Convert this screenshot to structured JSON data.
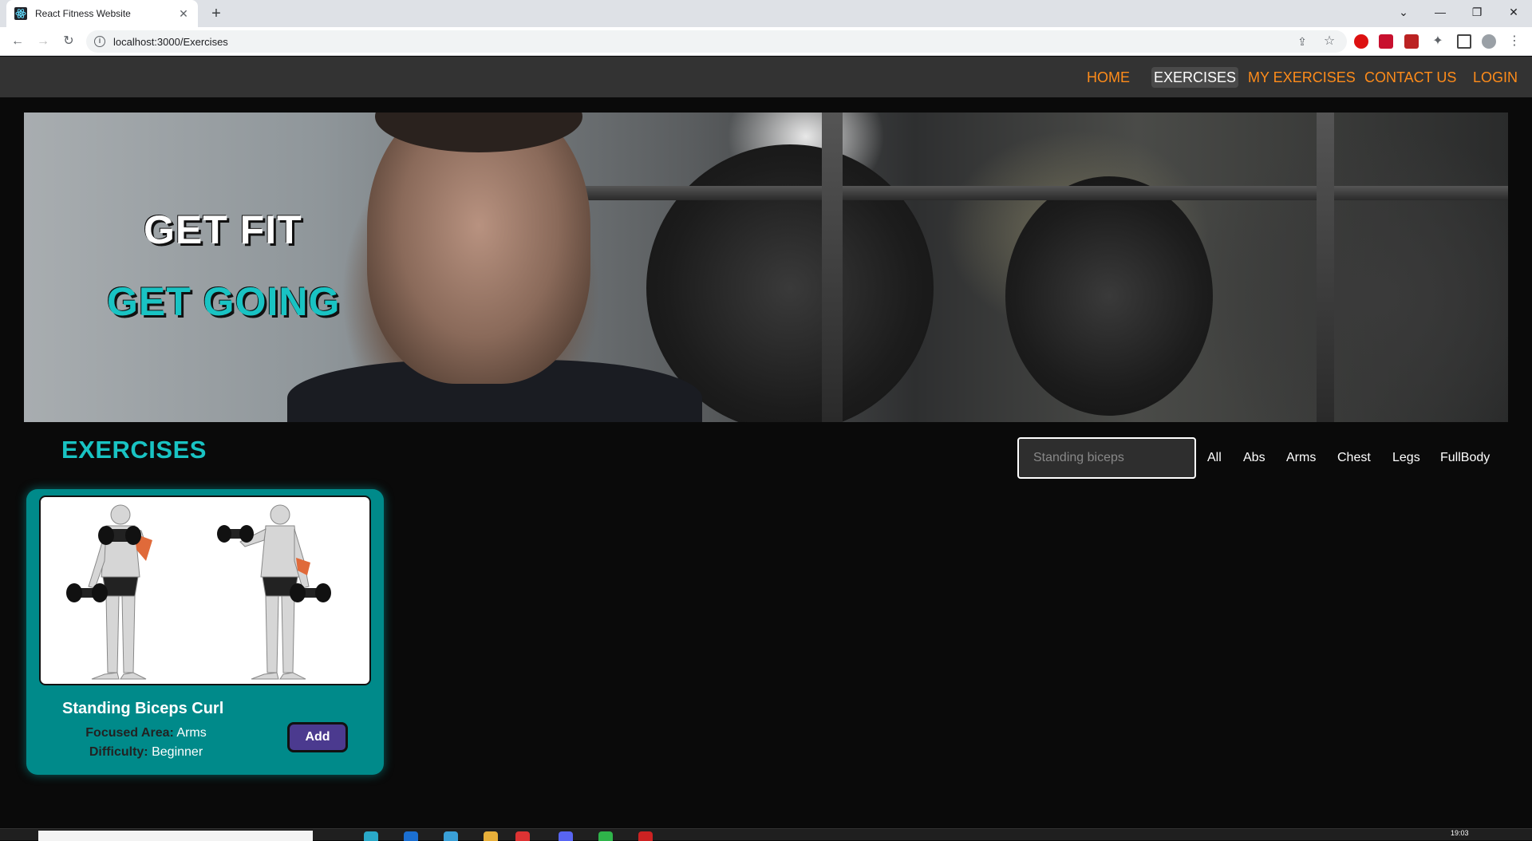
{
  "browser": {
    "tab_title": "React Fitness Website",
    "tab_close": "✕",
    "new_tab": "+",
    "url": "localhost:3000/Exercises",
    "window_controls": [
      "⌄",
      "—",
      "❐",
      "✕"
    ]
  },
  "nav": {
    "links": [
      "HOME",
      "EXERCISES",
      "MY EXERCISES",
      "CONTACT US",
      "LOGIN"
    ],
    "active": "EXERCISES",
    "colors": {
      "link": "#ff8c1a",
      "active": "#ffffff"
    }
  },
  "hero": {
    "line1": "GET FIT",
    "line2": "GET GOING"
  },
  "exercises": {
    "title": "EXERCISES",
    "search_value": "Standing biceps",
    "filters": [
      "All",
      "Abs",
      "Arms",
      "Chest",
      "Legs",
      "FullBody"
    ]
  },
  "cards": [
    {
      "name": "Standing Biceps Curl",
      "focused_area_label": "Focused Area:",
      "focused_area": "Arms",
      "difficulty_label": "Difficulty:",
      "difficulty": "Beginner",
      "add_label": "Add"
    }
  ],
  "taskbar": {
    "clock": "19:03"
  },
  "colors": {
    "accent": "#19c3c3",
    "card": "#008a8a",
    "add_button": "#4b3a8f",
    "background": "#0a0a0a"
  }
}
